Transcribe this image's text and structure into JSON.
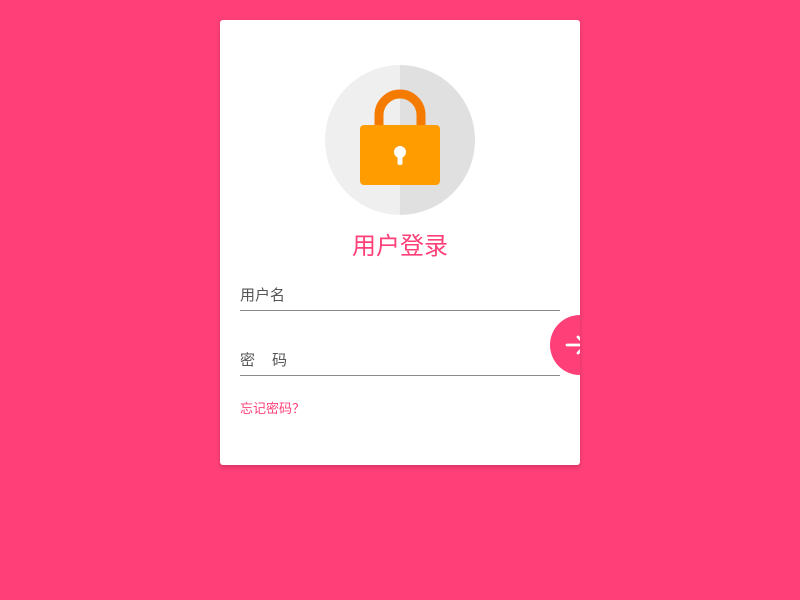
{
  "colors": {
    "background": "#ff4078",
    "accent": "#ff4078",
    "card": "#ffffff",
    "lock_body": "#ff9c00",
    "lock_shackle": "#f47b00"
  },
  "login": {
    "title": "用户登录",
    "username_placeholder": "用户名",
    "password_placeholder": "密　码",
    "forgot_link": "忘记密码？"
  },
  "icons": {
    "avatar": "lock-icon",
    "submit": "arrow-right-icon"
  }
}
